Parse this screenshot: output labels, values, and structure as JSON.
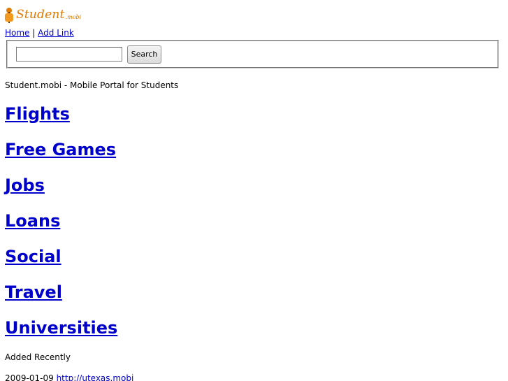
{
  "logo": {
    "text": "Student",
    "suffix": ".mobi"
  },
  "nav": {
    "home": "Home",
    "separator": "|",
    "add_link": "Add Link"
  },
  "search": {
    "value": "",
    "button_label": "Search"
  },
  "tagline": "Student.mobi - Mobile Portal for Students",
  "categories": [
    {
      "label": "Flights"
    },
    {
      "label": "Free Games"
    },
    {
      "label": "Jobs"
    },
    {
      "label": "Loans"
    },
    {
      "label": "Social"
    },
    {
      "label": "Travel"
    },
    {
      "label": "Universities"
    }
  ],
  "recent": {
    "heading": "Added Recently",
    "items": [
      {
        "date": "2009-01-09",
        "link": "http://utexas.mobi"
      }
    ]
  },
  "colors": {
    "link": "#0000cc",
    "logo_orange": "#e27800",
    "background": "#ffffff"
  }
}
